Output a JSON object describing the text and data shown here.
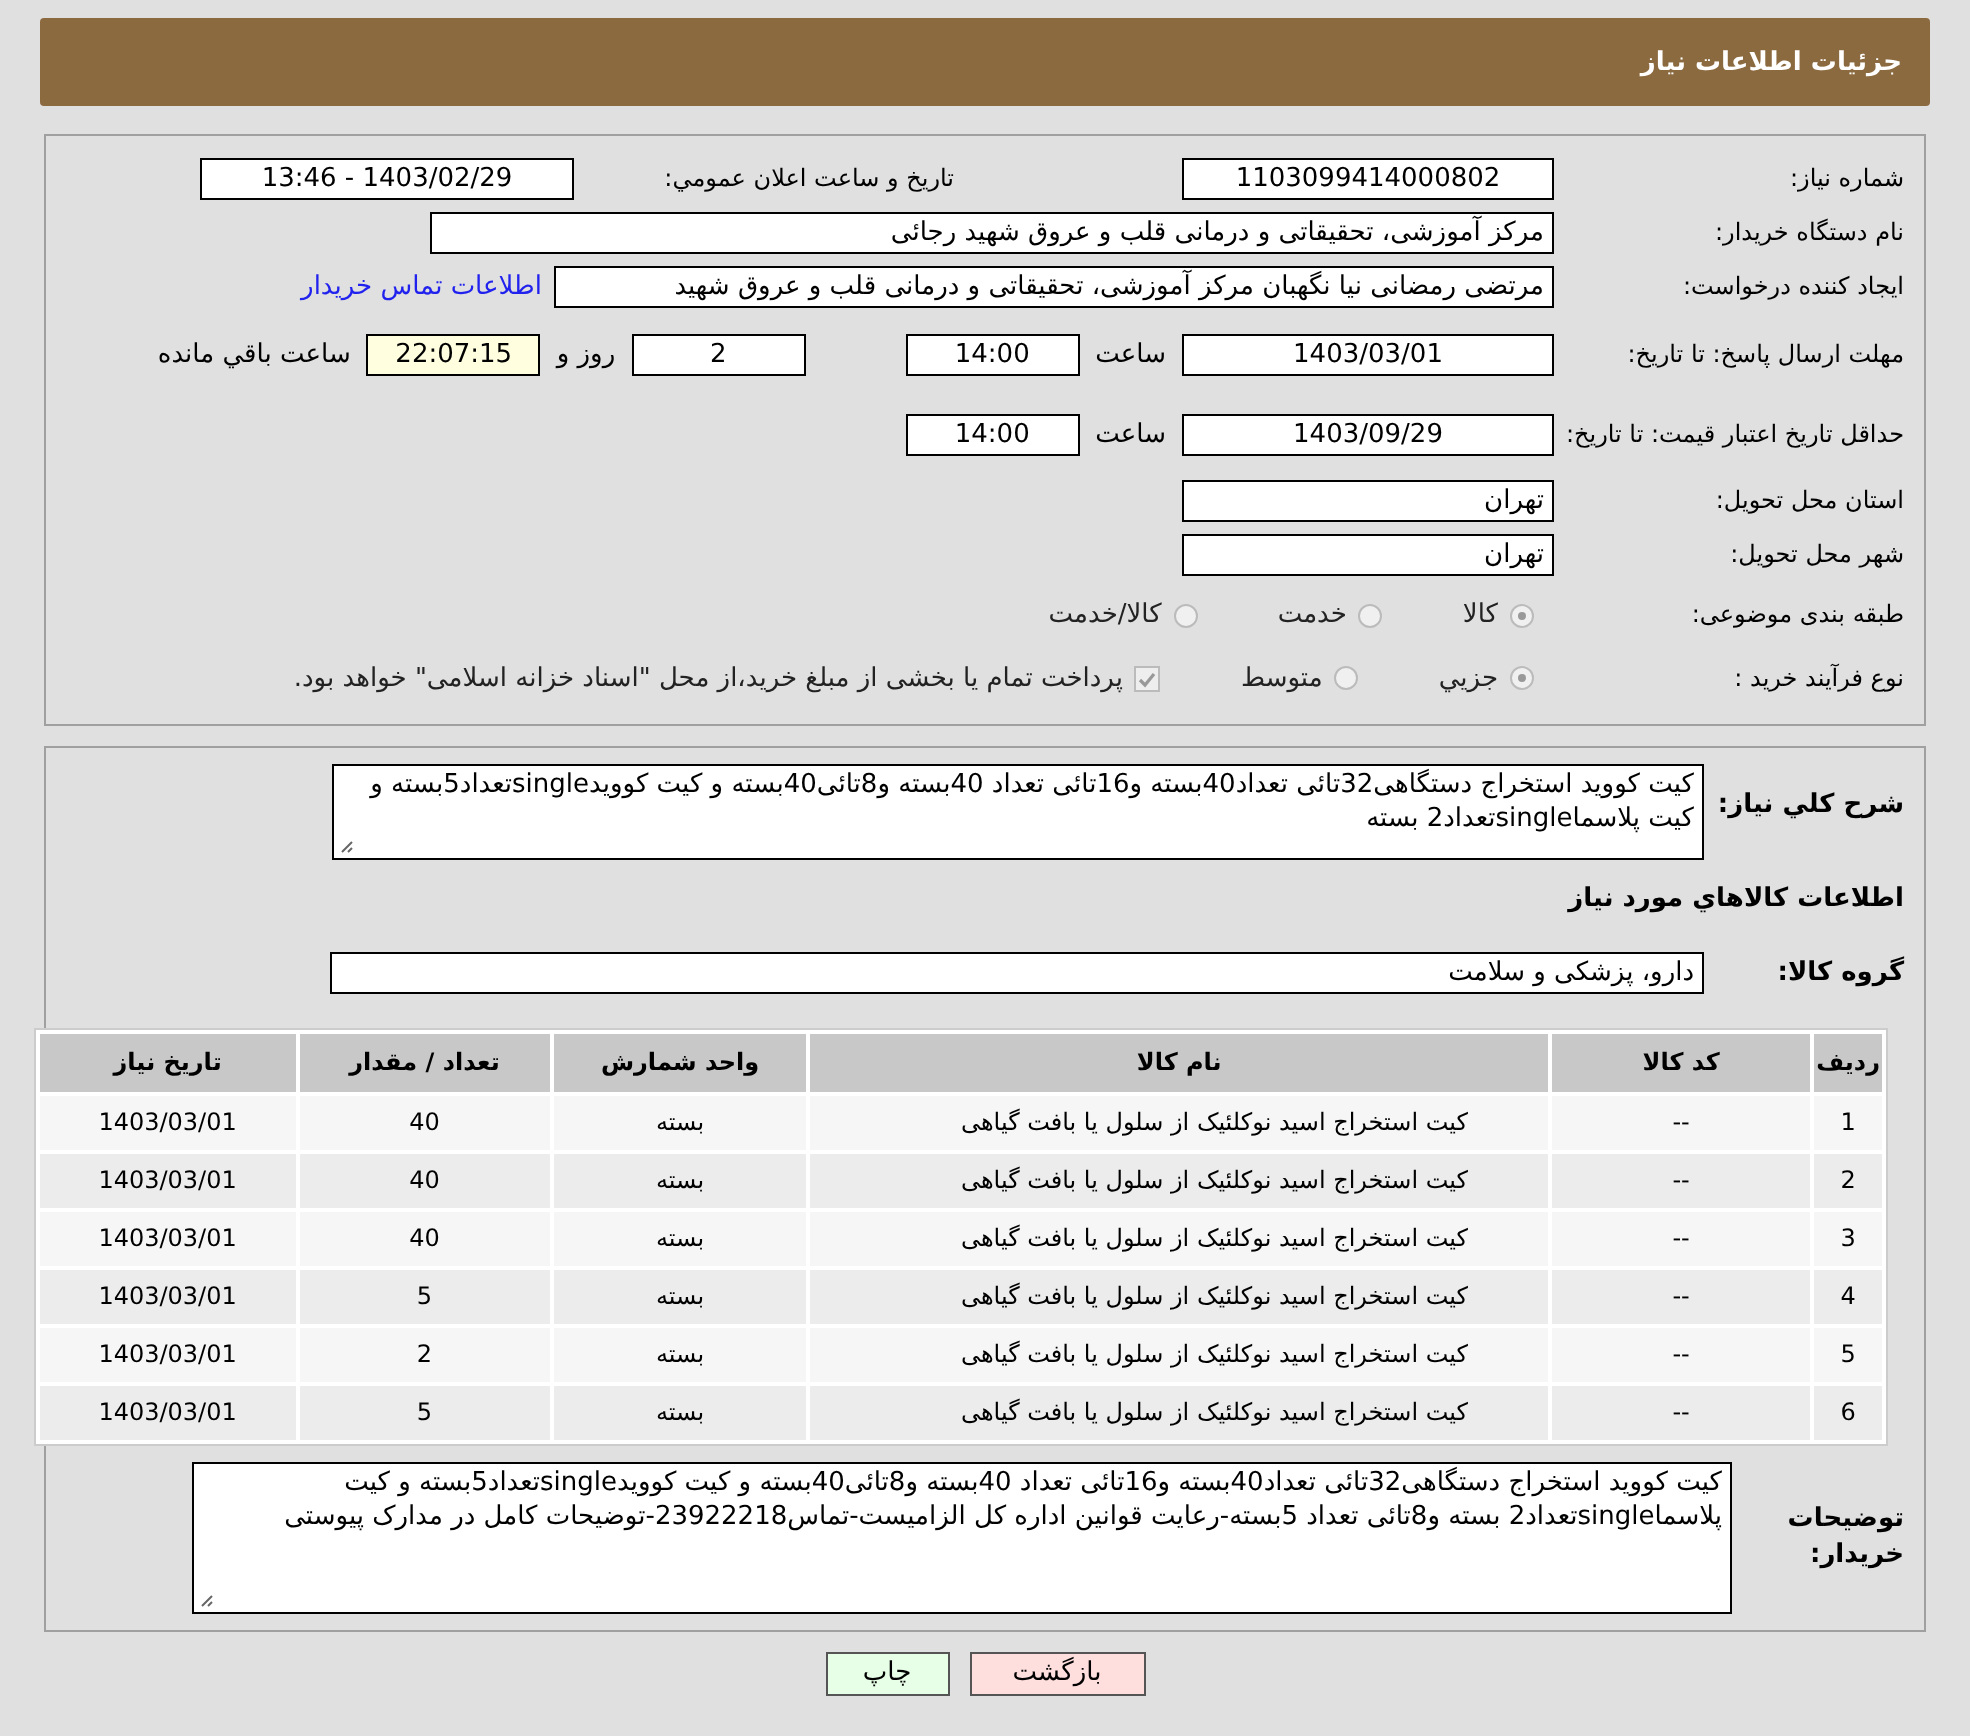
{
  "header": {
    "title": "جزئیات اطلاعات نیاز"
  },
  "details": {
    "need_number": {
      "label": "شماره نیاز:",
      "value": "1103099414000802"
    },
    "announce": {
      "label": "تاريخ و ساعت اعلان عمومي:",
      "value": "1403/02/29 - 13:46"
    },
    "buyer": {
      "label": "نام دستگاه خریدار:",
      "value": "مرکز آموزشی، تحقیقاتی و درمانی قلب و عروق شهید رجائی"
    },
    "creator": {
      "label": "ایجاد کننده درخواست:",
      "value": "مرتضی رمضانی نیا نگهبان مرکز آموزشی، تحقیقاتی و درمانی قلب و عروق شهید",
      "link": "اطلاعات تماس خریدار"
    },
    "deadline": {
      "label": "مهلت ارسال پاسخ: تا تاریخ:",
      "date": "1403/03/01",
      "time_label": "ساعت",
      "time": "14:00",
      "days": "2",
      "days_label": "روز و",
      "remaining": "22:07:15",
      "remaining_label": "ساعت باقي مانده"
    },
    "validity": {
      "label": "حداقل تاریخ اعتبار قیمت: تا تاریخ:",
      "date": "1403/09/29",
      "time_label": "ساعت",
      "time": "14:00"
    },
    "province": {
      "label": "استان محل تحویل:",
      "value": "تهران"
    },
    "city": {
      "label": "شهر محل تحویل:",
      "value": "تهران"
    },
    "category": {
      "label": "طبقه بندی موضوعی:",
      "options": [
        {
          "label": "کالا",
          "selected": true
        },
        {
          "label": "خدمت",
          "selected": false
        },
        {
          "label": "کالا/خدمت",
          "selected": false
        }
      ]
    },
    "purchase_type": {
      "label": "نوع فرآیند خرید :",
      "options": [
        {
          "kind": "radio",
          "label": "جزيي",
          "selected": true
        },
        {
          "kind": "radio",
          "label": "متوسط",
          "selected": false
        },
        {
          "kind": "checkbox",
          "label": "پرداخت تمام یا بخشی از مبلغ خرید،از محل \"اسناد خزانه اسلامی\" خواهد بود.",
          "checked": true
        }
      ]
    }
  },
  "need": {
    "summary_label": "شرح کلي نیاز:",
    "summary": "کیت کووید استخراج دستگاهی32تائی تعداد40بسته و16تائی تعداد 40بسته و8تائی40بسته و کیت کوویدsingleتعداد5بسته و کیت پلاسماsingleتعداد2 بسته",
    "goods_heading": "اطلاعات کالاهاي مورد نیاز",
    "group_label": "گروه کالا:",
    "group": "دارو، پزشکی و سلامت"
  },
  "table": {
    "columns": [
      "ردیف",
      "کد کالا",
      "نام کالا",
      "واحد شمارش",
      "تعداد / مقدار",
      "تاریخ نیاز"
    ],
    "rows": [
      [
        "1",
        "--",
        "کیت استخراج اسید نوکلئیک از سلول یا بافت گیاهی",
        "بسته",
        "40",
        "1403/03/01"
      ],
      [
        "2",
        "--",
        "کیت استخراج اسید نوکلئیک از سلول یا بافت گیاهی",
        "بسته",
        "40",
        "1403/03/01"
      ],
      [
        "3",
        "--",
        "کیت استخراج اسید نوکلئیک از سلول یا بافت گیاهی",
        "بسته",
        "40",
        "1403/03/01"
      ],
      [
        "4",
        "--",
        "کیت استخراج اسید نوکلئیک از سلول یا بافت گیاهی",
        "بسته",
        "5",
        "1403/03/01"
      ],
      [
        "5",
        "--",
        "کیت استخراج اسید نوکلئیک از سلول یا بافت گیاهی",
        "بسته",
        "2",
        "1403/03/01"
      ],
      [
        "6",
        "--",
        "کیت استخراج اسید نوکلئیک از سلول یا بافت گیاهی",
        "بسته",
        "5",
        "1403/03/01"
      ]
    ]
  },
  "buyer_notes": {
    "label": "توضیحات خریدار:",
    "value": "کیت کووید استخراج دستگاهی32تائی تعداد40بسته و16تائی تعداد 40بسته و8تائی40بسته و کیت کوویدsingleتعداد5بسته و کیت پلاسماsingleتعداد2 بسته و8تائی تعداد 5بسته-رعایت قوانین اداره کل الزامیست-تماس23922218-توضیحات کامل در مدارک پیوستی"
  },
  "buttons": [
    {
      "kind": "back",
      "label": "بازگشت"
    },
    {
      "kind": "print",
      "label": "چاپ"
    }
  ]
}
